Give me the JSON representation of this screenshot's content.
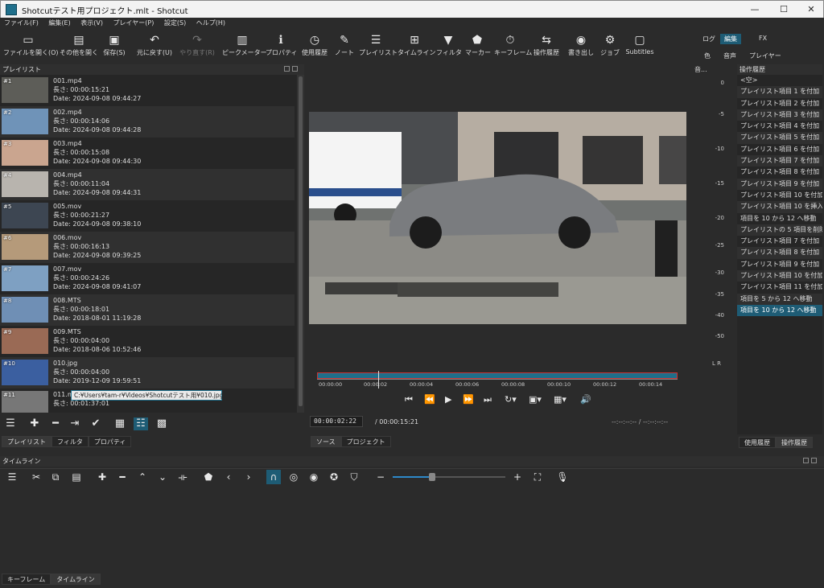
{
  "window": {
    "title": "Shotcutテスト用プロジェクト.mlt - Shotcut",
    "minimize": "—",
    "maximize": "☐",
    "close": "✕"
  },
  "menu": [
    "ファイル(F)",
    "編集(E)",
    "表示(V)",
    "プレイヤー(P)",
    "設定(S)",
    "ヘルプ(H)"
  ],
  "toolbar": {
    "open_file": "ファイルを開く(O)",
    "open_other": "その他を開く",
    "save": "保存(S)",
    "undo": "元に戻す(U)",
    "redo": "やり直す(R)",
    "peak_meter": "ピークメーター",
    "properties": "プロパティ",
    "recent": "使用履歴",
    "notes": "ノート",
    "playlist": "プレイリスト",
    "timeline": "タイムライン",
    "filters": "フィルタ",
    "markers": "マーカー",
    "keyframes": "キーフレーム",
    "history": "操作履歴",
    "export": "書き出し",
    "jobs": "ジョブ",
    "subtitles": "Subtitles"
  },
  "layouts": {
    "log": "ログ",
    "edit": "編集",
    "fx": "FX",
    "color": "色",
    "audio": "音声",
    "player": "プレイヤー"
  },
  "panels": {
    "playlist_title": "プレイリスト",
    "meter_title": "音...",
    "history_title": "操作履歴",
    "timeline_title": "タイムライン"
  },
  "playlist_items": [
    {
      "num": "#1",
      "name": "001.mp4",
      "length": "長さ: 00:00:15:21",
      "date": "Date: 2024-09-08 09:44:27",
      "thumb": "#5d5d58"
    },
    {
      "num": "#2",
      "name": "002.mp4",
      "length": "長さ: 00:00:14:06",
      "date": "Date: 2024-09-08 09:44:28",
      "thumb": "#6f93b8"
    },
    {
      "num": "#3",
      "name": "003.mp4",
      "length": "長さ: 00:00:15:08",
      "date": "Date: 2024-09-08 09:44:30",
      "thumb": "#caa58f"
    },
    {
      "num": "#4",
      "name": "004.mp4",
      "length": "長さ: 00:00:11:04",
      "date": "Date: 2024-09-08 09:44:31",
      "thumb": "#b8b4ae"
    },
    {
      "num": "#5",
      "name": "005.mov",
      "length": "長さ: 00:00:21:27",
      "date": "Date: 2024-09-08 09:38:10",
      "thumb": "#3d4652"
    },
    {
      "num": "#6",
      "name": "006.mov",
      "length": "長さ: 00:00:16:13",
      "date": "Date: 2024-09-08 09:39:25",
      "thumb": "#b59a7a"
    },
    {
      "num": "#7",
      "name": "007.mov",
      "length": "長さ: 00:00:24:26",
      "date": "Date: 2024-09-08 09:41:07",
      "thumb": "#7ea0c2"
    },
    {
      "num": "#8",
      "name": "008.MTS",
      "length": "長さ: 00:00:18:01",
      "date": "Date: 2018-08-01 11:19:28",
      "thumb": "#6f8fb5"
    },
    {
      "num": "#9",
      "name": "009.MTS",
      "length": "長さ: 00:00:04:00",
      "date": "Date: 2018-08-06 10:52:46",
      "thumb": "#9a6a55"
    },
    {
      "num": "#10",
      "name": "010.jpg",
      "length": "長さ: 00:00:04:00",
      "date": "Date: 2019-12-09 19:59:51",
      "thumb": "#3b5fa0"
    },
    {
      "num": "#11",
      "name": "011.m",
      "length": "長さ: 00:01:37:01",
      "date": "",
      "thumb": "#777777"
    }
  ],
  "tooltip": "C:¥Users¥tam-r¥Videos¥Shotcutテスト用¥010.jpg",
  "bottom_tabs_left": [
    "プレイリスト",
    "フィルタ",
    "プロパティ"
  ],
  "bottom_tabs_center": [
    "ソース",
    "プロジェクト"
  ],
  "bottom_tabs_right": [
    "使用履歴",
    "操作履歴"
  ],
  "bottom_tabs_timeline": [
    "キーフレーム",
    "タイムライン"
  ],
  "meter_scale": [
    "0",
    "-5",
    "-10",
    "-15",
    "-20",
    "-25",
    "-30",
    "-35",
    "-40",
    "-50"
  ],
  "meter_lr": "L R",
  "ruler_labels": [
    "00:00:00",
    "00:00:02",
    "00:00:04",
    "00:00:06",
    "00:00:08",
    "00:00:10",
    "00:00:12",
    "00:00:14"
  ],
  "player": {
    "timecode": "00:00:02:22",
    "duration": "/  00:00:15:21",
    "inout": "--:--:--:--  /  --:--:--:--"
  },
  "history_items": [
    "<空>",
    "プレイリスト項目 1 を付加",
    "プレイリスト項目 2 を付加",
    "プレイリスト項目 3 を付加",
    "プレイリスト項目 4 を付加",
    "プレイリスト項目 5 を付加",
    "プレイリスト項目 6 を付加",
    "プレイリスト項目 7 を付加",
    "プレイリスト項目 8 を付加",
    "プレイリスト項目 9 を付加",
    "プレイリスト項目 10 を付加",
    "プレイリスト項目 10 を挿入",
    "項目を 10 から 12 へ移動",
    "プレイリストの 5 項目を削除",
    "プレイリスト項目 7 を付加",
    "プレイリスト項目 8 を付加",
    "プレイリスト項目 9 を付加",
    "プレイリスト項目 10 を付加",
    "プレイリスト項目 11 を付加",
    "項目を 5 から 12 へ移動",
    "項目を 10 から 12 へ移動"
  ],
  "timeline": {
    "zoom_fraction": 0.35
  },
  "colors": {
    "accent": "#1e5c75",
    "bar": "#1f6f8b",
    "in_out": "#cc3333"
  }
}
